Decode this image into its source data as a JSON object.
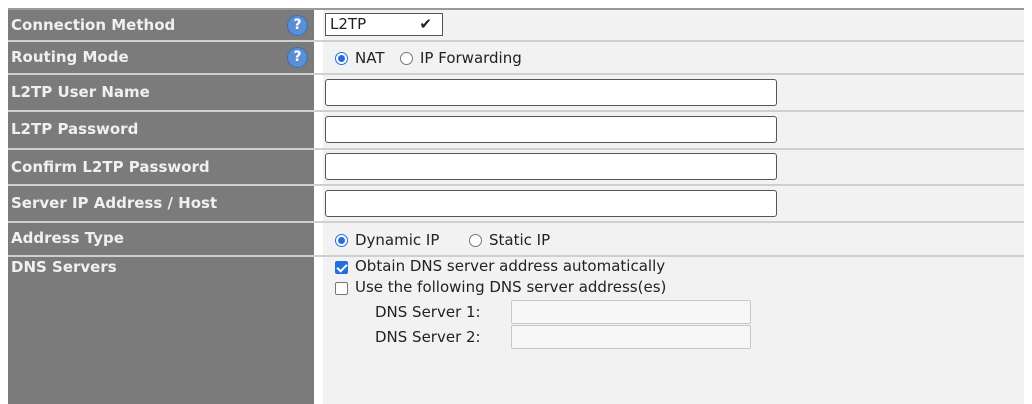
{
  "connection_method": {
    "label": "Connection Method",
    "value": "L2TP"
  },
  "routing_mode": {
    "label": "Routing Mode",
    "options": [
      "NAT",
      "IP Forwarding"
    ],
    "selected": "NAT"
  },
  "l2tp_user_name": {
    "label": "L2TP User Name",
    "value": ""
  },
  "l2tp_password": {
    "label": "L2TP Password",
    "value": ""
  },
  "confirm_password": {
    "label": "Confirm L2TP Password",
    "value": ""
  },
  "server_address": {
    "label": "Server IP Address / Host",
    "value": ""
  },
  "address_type": {
    "label": "Address Type",
    "options": [
      "Dynamic IP",
      "Static IP"
    ],
    "selected": "Dynamic IP"
  },
  "dns_servers": {
    "label": "DNS Servers",
    "auto_label": "Obtain DNS server address automatically",
    "auto_checked": true,
    "manual_label": "Use the following DNS server address(es)",
    "manual_checked": false,
    "server1_label": "DNS Server 1:",
    "server2_label": "DNS Server 2:",
    "server1_value": "",
    "server2_value": ""
  },
  "help_glyph": "?",
  "icons": {
    "help": "help-question-icon",
    "dropdown": "chevron-down-icon"
  },
  "colors": {
    "label_bg": "#7b7b7b",
    "value_bg": "#f2f2f2",
    "accent": "#1f6fe0",
    "help": "#5a8fd6"
  }
}
